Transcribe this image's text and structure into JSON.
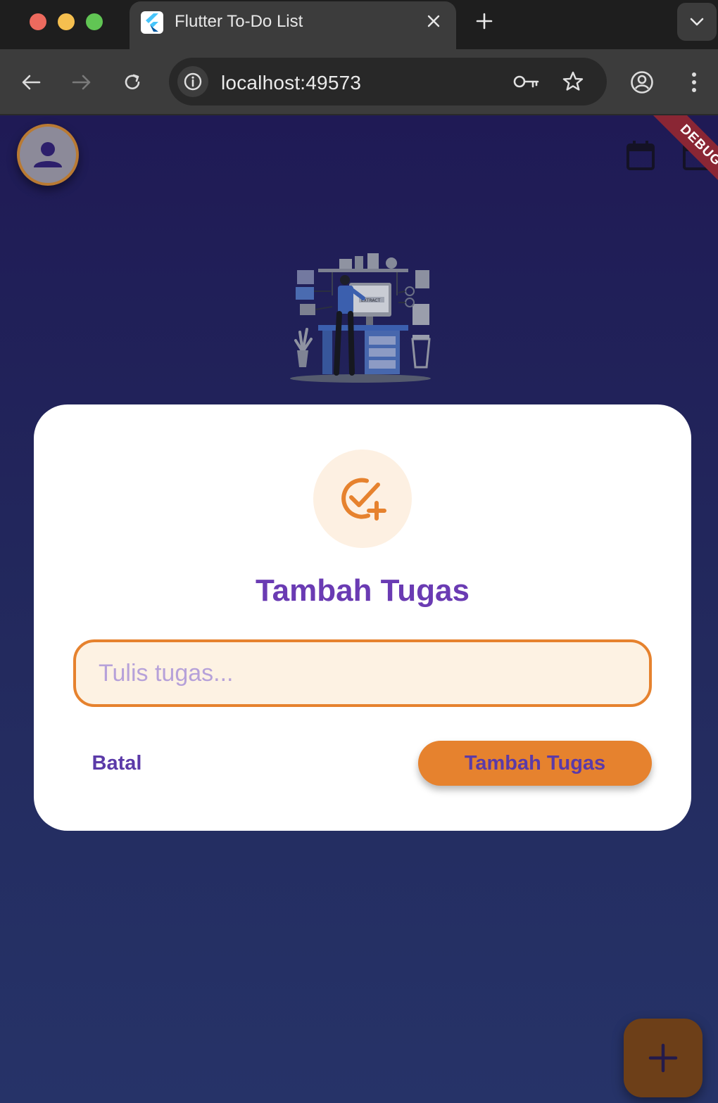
{
  "browser": {
    "tab_title": "Flutter To-Do List",
    "url": "localhost:49573"
  },
  "app": {
    "debug_label": "DEBUG",
    "illustration_text": "EXTRACT",
    "dialog": {
      "icon": "add-task-icon",
      "title": "Tambah Tugas",
      "input_placeholder": "Tulis tugas...",
      "input_value": "",
      "cancel_label": "Batal",
      "submit_label": "Tambah Tugas"
    },
    "colors": {
      "accent": "#e6822e",
      "primary_text": "#6a3bb3",
      "background_top": "#1f1a55",
      "background_bottom": "#263368"
    }
  }
}
